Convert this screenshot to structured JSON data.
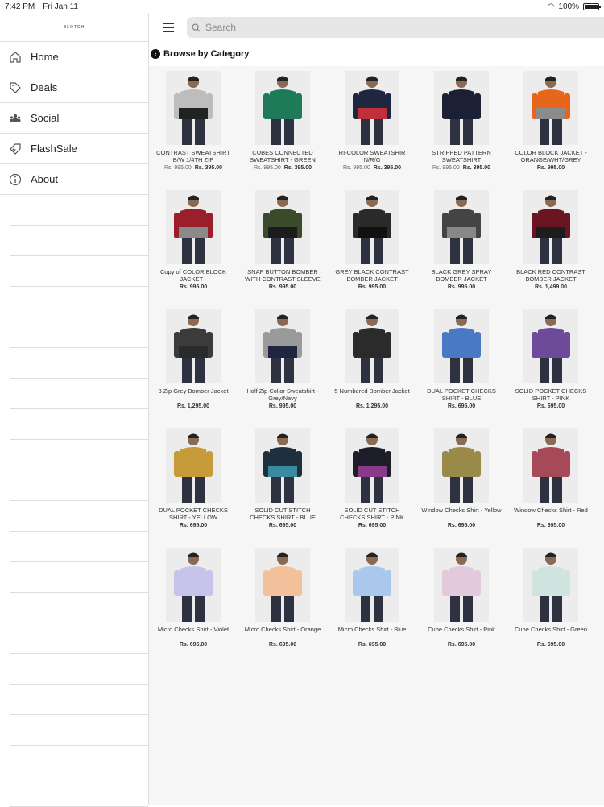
{
  "status": {
    "time": "7:42 PM",
    "date": "Fri Jan 11",
    "battery": "100%",
    "battery_level": 1.0
  },
  "brand": "BLOTCH",
  "search": {
    "placeholder": "Search"
  },
  "sidebar": {
    "items": [
      {
        "label": "Home",
        "icon": "home-icon"
      },
      {
        "label": "Deals",
        "icon": "tag-icon"
      },
      {
        "label": "Social",
        "icon": "people-icon"
      },
      {
        "label": "FlashSale",
        "icon": "flash-tag-icon"
      },
      {
        "label": "About",
        "icon": "info-icon"
      }
    ]
  },
  "category": {
    "title": "Browse by Category"
  },
  "products": [
    {
      "name": "CONTRAST SWEATSHIRT B/W 1/4TH ZIP",
      "old_price": "Rs. 995.00",
      "price": "Rs. 395.00",
      "top": "#bdbdbd",
      "bottom": "#222"
    },
    {
      "name": "CUBES CONNECTED SWEATSHIRT - GREEN",
      "old_price": "Rs. 995.00",
      "price": "Rs. 395.00",
      "top": "#1f7a5a",
      "bottom": "#1f7a5a"
    },
    {
      "name": "TRI-COLOR SWEATSHIRT N/R/G",
      "old_price": "Rs. 995.00",
      "price": "Rs. 395.00",
      "top": "#1e2640",
      "bottom": "#c0303a"
    },
    {
      "name": "STRIPPED PATTERN SWEATSHIRT",
      "old_price": "Rs. 995.00",
      "price": "Rs. 395.00",
      "top": "#1c2035",
      "bottom": "#1c2035"
    },
    {
      "name": "COLOR BLOCK JACKET - ORANGE/WHT/GREY",
      "old_price": "",
      "price": "Rs. 995.00",
      "top": "#e8661c",
      "bottom": "#8b8b8b"
    },
    {
      "name": "Copy of COLOR BLOCK JACKET -",
      "old_price": "",
      "price": "Rs. 995.00",
      "top": "#9a1f2a",
      "bottom": "#8a8a8a"
    },
    {
      "name": "SNAP BUTTON BOMBER WITH CONTRAST SLEEVE",
      "old_price": "",
      "price": "Rs. 995.00",
      "top": "#3b4a2a",
      "bottom": "#1c1c1c"
    },
    {
      "name": "GREY BLACK CONTRAST BOMBER JACKET",
      "old_price": "",
      "price": "Rs. 995.00",
      "top": "#2a2a2a",
      "bottom": "#111"
    },
    {
      "name": "BLACK GREY SPRAY BOMBER JACKET",
      "old_price": "",
      "price": "Rs. 995.00",
      "top": "#444",
      "bottom": "#888"
    },
    {
      "name": "BLACK RED CONTRAST BOMBER JACKET",
      "old_price": "",
      "price": "Rs. 1,499.00",
      "top": "#6a1522",
      "bottom": "#1d1d1d"
    },
    {
      "name": "3 Zip Grey Bomber Jacket",
      "old_price": "",
      "price": "Rs. 1,295.00",
      "top": "#3b3b3b",
      "bottom": "#2a2a2a"
    },
    {
      "name": "Half Zip Collar Sweatshirt - Grey/Navy",
      "old_price": "",
      "price": "Rs. 995.00",
      "top": "#9a9a9a",
      "bottom": "#1e2640"
    },
    {
      "name": "5 Numbered Bomber Jacket",
      "old_price": "",
      "price": "Rs. 1,295.00",
      "top": "#2b2b2b",
      "bottom": "#2b2b2b"
    },
    {
      "name": "DUAL POCKET CHECKS SHIRT - BLUE",
      "old_price": "",
      "price": "Rs. 695.00",
      "top": "#4a78c2",
      "bottom": "#4a78c2"
    },
    {
      "name": "SOLID POCKET CHECKS SHIRT - PINK",
      "old_price": "",
      "price": "Rs. 695.00",
      "top": "#6d4a9a",
      "bottom": "#6d4a9a"
    },
    {
      "name": "DUAL POCKET CHECKS SHIRT - YELLOW",
      "old_price": "",
      "price": "Rs. 695.00",
      "top": "#c79a3a",
      "bottom": "#c79a3a"
    },
    {
      "name": "SOLID CUT STITCH CHECKS SHIRT - BLUE",
      "old_price": "",
      "price": "Rs. 695.00",
      "top": "#1e2f3e",
      "bottom": "#3a8aa0"
    },
    {
      "name": "SOLID CUT STITCH CHECKS SHIRT - PINK",
      "old_price": "",
      "price": "Rs. 695.00",
      "top": "#1e1e2a",
      "bottom": "#8a3a8a"
    },
    {
      "name": "Window Checks Shirt - Yellow",
      "old_price": "",
      "price": "Rs. 695.00",
      "top": "#9a8a4a",
      "bottom": "#9a8a4a"
    },
    {
      "name": "Window Checks Shirt - Red",
      "old_price": "",
      "price": "Rs. 695.00",
      "top": "#a64a5a",
      "bottom": "#a64a5a"
    },
    {
      "name": "Micro Checks Shirt - Violet",
      "old_price": "",
      "price": "Rs. 695.00",
      "top": "#c7c3ea",
      "bottom": "#c7c3ea"
    },
    {
      "name": "Micro Checks Shirt - Orange",
      "old_price": "",
      "price": "Rs. 695.00",
      "top": "#f2c09a",
      "bottom": "#f2c09a"
    },
    {
      "name": "Micro Checks Shirt - Blue",
      "old_price": "",
      "price": "Rs. 695.00",
      "top": "#a9c8ec",
      "bottom": "#a9c8ec"
    },
    {
      "name": "Cube Checks Shirt - Pink",
      "old_price": "",
      "price": "Rs. 695.00",
      "top": "#e2c9dc",
      "bottom": "#e2c9dc"
    },
    {
      "name": "Cube Checks Shirt - Green",
      "old_price": "",
      "price": "Rs. 695.00",
      "top": "#cfe4df",
      "bottom": "#cfe4df"
    }
  ]
}
